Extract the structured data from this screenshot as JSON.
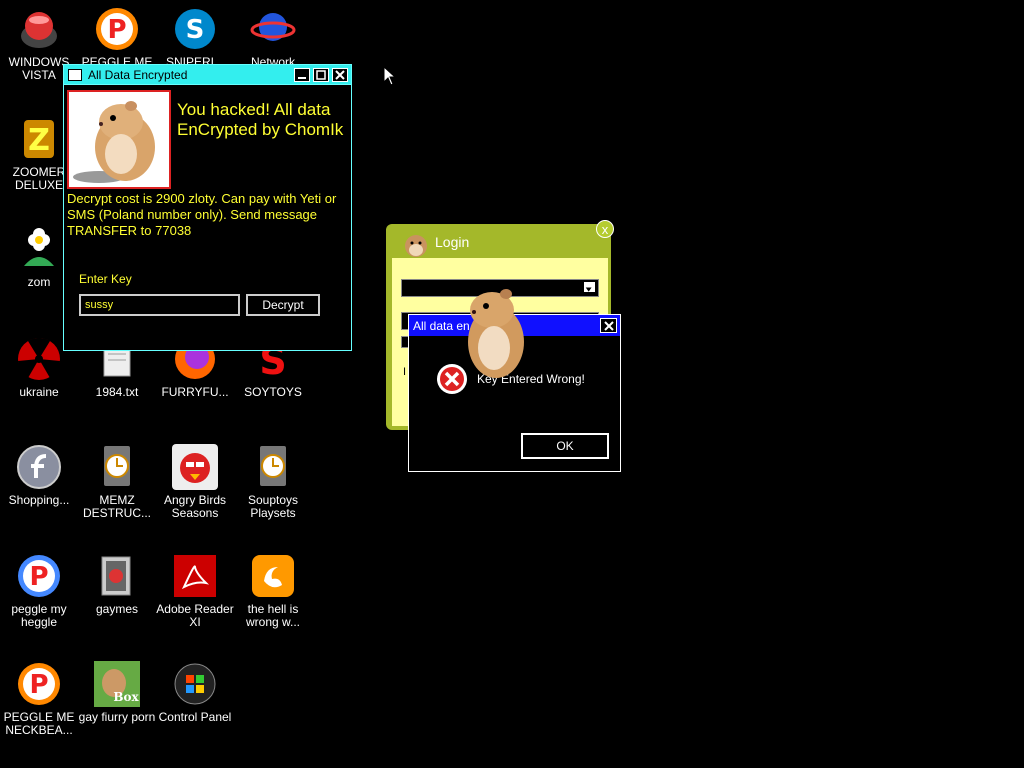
{
  "desktop_icons": [
    {
      "id": "windows-vista",
      "label": "WINDOWS VISTA",
      "icon": "vista-orb-icon"
    },
    {
      "id": "peggle-me-1",
      "label": "PEGGLE ME",
      "icon": "peggle-icon"
    },
    {
      "id": "sniper",
      "label": "SNIPERI...",
      "icon": "skype-icon"
    },
    {
      "id": "network",
      "label": "Network",
      "icon": "globe-icon"
    },
    {
      "id": "zoomer",
      "label": "ZOOMER DELUXE",
      "icon": "zuma-icon"
    },
    {
      "id": "zom",
      "label": "zom",
      "icon": "flower-icon"
    },
    {
      "id": "ukraine",
      "label": "ukraine",
      "icon": "radiation-icon"
    },
    {
      "id": "1984",
      "label": "1984.txt",
      "icon": "text-file-icon"
    },
    {
      "id": "furryfu",
      "label": "FURRYFU...",
      "icon": "firefox-icon"
    },
    {
      "id": "soytoys",
      "label": "SOYTOYS",
      "icon": "red-s-icon"
    },
    {
      "id": "shopping",
      "label": "Shopping...",
      "icon": "flash-icon"
    },
    {
      "id": "memz",
      "label": "MEMZ DESTRUC...",
      "icon": "clock-file-icon"
    },
    {
      "id": "angry-birds",
      "label": "Angry Birds Seasons",
      "icon": "angry-birds-icon"
    },
    {
      "id": "souptoys",
      "label": "Souptoys Playsets",
      "icon": "clock-file-icon"
    },
    {
      "id": "peggle-heggle",
      "label": "peggle my heggle",
      "icon": "peggle-icon"
    },
    {
      "id": "gaymes",
      "label": "gaymes",
      "icon": "folder-icon"
    },
    {
      "id": "adobe",
      "label": "Adobe Reader XI",
      "icon": "adobe-reader-icon"
    },
    {
      "id": "hell",
      "label": "the hell is wrong w...",
      "icon": "uc-browser-icon"
    },
    {
      "id": "peggle-neck",
      "label": "PEGGLE ME NECKBEA...",
      "icon": "peggle-icon"
    },
    {
      "id": "gay-fiurry",
      "label": "gay fiurry porn",
      "icon": "hamster-box-icon"
    },
    {
      "id": "control-panel",
      "label": "Control Panel",
      "icon": "control-panel-icon"
    }
  ],
  "ransom_window": {
    "title": "All Data Encrypted",
    "headline": "You hacked! All data EnCrypted by ChomIk",
    "cost_text": "Decrypt cost is 2900 zloty. Can pay with Yeti or SMS (Poland number only). Send message TRANSFER to 77038",
    "enter_key_label": "Enter Key",
    "key_value": "sussy",
    "decrypt_button": "Decrypt"
  },
  "login_window": {
    "title": "Login",
    "close_glyph": "x",
    "text_fragment": "I"
  },
  "error_dialog": {
    "title": "All data en",
    "message": "Key Entered Wrong!",
    "ok_button": "OK"
  },
  "colors": {
    "ransom_titlebar": "#33eeee",
    "ransom_text": "#ffff33",
    "dialog_titlebar": "#1010ff",
    "login_frame": "#a4b82a"
  }
}
